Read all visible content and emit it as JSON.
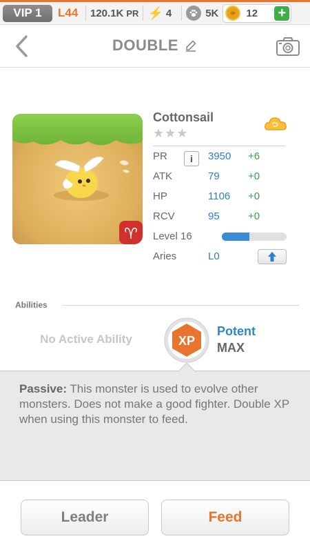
{
  "status": {
    "vip": "VIP 1",
    "level": "L44",
    "power": "120.1K",
    "power_unit": "PR",
    "energy": "4",
    "paws": "5K",
    "coins": "12",
    "add_icon": "plus-icon"
  },
  "header": {
    "title": "DOUBLE",
    "back_icon": "chevron-left-icon",
    "edit_icon": "pencil-icon",
    "camera_icon": "camera-icon"
  },
  "monster": {
    "name": "Cottonsail",
    "stars": "★★★",
    "element_icon": "cloud-icon",
    "stats": [
      {
        "label": "PR",
        "value": "3950",
        "delta": "+6"
      },
      {
        "label": "ATK",
        "value": "79",
        "delta": "+0"
      },
      {
        "label": "HP",
        "value": "1106",
        "delta": "+0"
      },
      {
        "label": "RCV",
        "value": "95",
        "delta": "+0"
      }
    ],
    "level_label": "Level 16",
    "level_progress": 0.43,
    "sign": "Aries",
    "sign_level": "L0"
  },
  "abilities": {
    "label": "Abilities",
    "active": "No Active Ability",
    "badge": "XP",
    "name": "Potent",
    "rank": "MAX"
  },
  "passive": {
    "label": "Passive:",
    "text": " This monster is used to evolve other monsters. Does not make a good fighter. Double XP when using this monster to feed."
  },
  "buttons": {
    "leader": "Leader",
    "feed": "Feed"
  },
  "colors": {
    "accent": "#e8742e",
    "stat_value": "#2d7fc8",
    "stat_delta": "#3aa24a",
    "sign": "#d0312d",
    "xp_badge": "#e8742e"
  }
}
